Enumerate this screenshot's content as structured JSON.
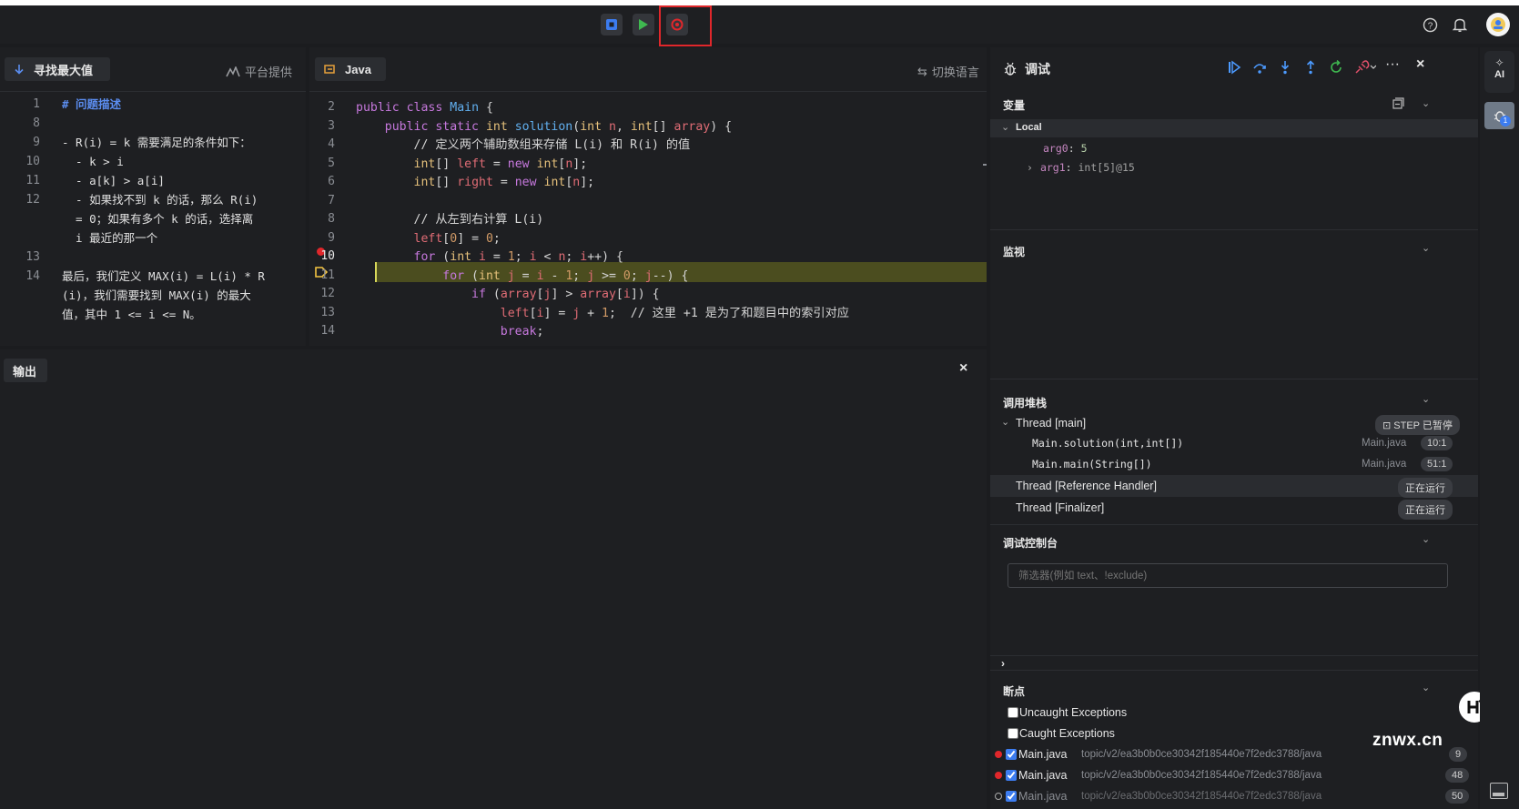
{
  "left_panel": {
    "tab_label": "寻找最大值",
    "provider_label": "平台提供",
    "lines": [
      {
        "num": "1",
        "text": "# 问题描述",
        "heading": true
      },
      {
        "num": "8",
        "text": ""
      },
      {
        "num": "9",
        "text": "- R(i) = k 需要满足的条件如下："
      },
      {
        "num": "10",
        "text": "  - k > i"
      },
      {
        "num": "11",
        "text": "  - a[k] > a[i]"
      },
      {
        "num": "12",
        "text": "  - 如果找不到 k 的话，那么 R(i)"
      },
      {
        "num": "",
        "text": "  = 0；如果有多个 k 的话，选择离"
      },
      {
        "num": "",
        "text": "  i 最近的那一个"
      },
      {
        "num": "13",
        "text": ""
      },
      {
        "num": "14",
        "text": "最后，我们定义 MAX(i) = L(i) * R"
      },
      {
        "num": "",
        "text": "(i)，我们需要找到 MAX(i) 的最大"
      },
      {
        "num": "",
        "text": "值，其中 1 <= i <= N。"
      }
    ]
  },
  "editor": {
    "tab_label": "Java",
    "switch_lang_label": "切换语言",
    "lines": [
      {
        "num": "2",
        "code": "public class Main {"
      },
      {
        "num": "3",
        "code": "    public static int solution(int n, int[] array) {"
      },
      {
        "num": "4",
        "code": "        // 定义两个辅助数组来存储 L(i) 和 R(i) 的值"
      },
      {
        "num": "5",
        "code": "        int[] left = new int[n];"
      },
      {
        "num": "6",
        "code": "        int[] right = new int[n];"
      },
      {
        "num": "7",
        "code": ""
      },
      {
        "num": "8",
        "code": "        // 从左到右计算 L(i)"
      },
      {
        "num": "9",
        "code": "        left[0] = 0;"
      },
      {
        "num": "10",
        "code": "        for (int i = 1; i < n; i++) {"
      },
      {
        "num": "11",
        "code": "            for (int j = i - 1; j >= 0; j--) {"
      },
      {
        "num": "12",
        "code": "                if (array[j] > array[i]) {"
      },
      {
        "num": "13",
        "code": "                    left[i] = j + 1;  // 这里 +1 是为了和题目中的索引对应"
      },
      {
        "num": "14",
        "code": "                    break;"
      }
    ]
  },
  "output": {
    "tab_label": "输出"
  },
  "debug": {
    "title": "调试",
    "variables": {
      "title": "变量",
      "scope": "Local",
      "items": [
        {
          "name": "arg0",
          "value": "5"
        },
        {
          "name": "arg1",
          "value": "int[5]@15"
        }
      ]
    },
    "watch": {
      "title": "监视"
    },
    "callstack": {
      "title": "调用堆栈",
      "threads": [
        {
          "name": "Thread [main]",
          "status": "STEP 已暂停"
        },
        {
          "name": "Thread [Reference Handler]",
          "status": "正在运行"
        },
        {
          "name": "Thread [Finalizer]",
          "status": "正在运行"
        }
      ],
      "frames": [
        {
          "name": "Main.solution(int,int[])",
          "file": "Main.java",
          "pos": "10:1"
        },
        {
          "name": "Main.main(String[])",
          "file": "Main.java",
          "pos": "51:1"
        }
      ]
    },
    "console": {
      "title": "调试控制台",
      "filter_placeholder": "筛选器(例如 text、!exclude)"
    },
    "breakpoints": {
      "title": "断点",
      "exceptions": [
        {
          "label": "Uncaught Exceptions",
          "checked": false
        },
        {
          "label": "Caught Exceptions",
          "checked": false
        }
      ],
      "items": [
        {
          "file": "Main.java",
          "path": "topic/v2/ea3b0b0ce30342f185440e7f2edc3788/java",
          "line": "9"
        },
        {
          "file": "Main.java",
          "path": "topic/v2/ea3b0b0ce30342f185440e7f2edc3788/java",
          "line": "48"
        },
        {
          "file": "Main.java",
          "path": "topic/v2/ea3b0b0ce30342f185440e7f2edc3788/java",
          "line": "50"
        }
      ]
    }
  },
  "right_rail": {
    "ai_label": "AI",
    "badge": "1"
  },
  "watermark": "znwx.cn",
  "colors": {
    "accent": "#3c7cf0",
    "breakpoint": "#e0272b",
    "current_line": "#4b4d1f",
    "run_green": "#3fb950",
    "highlight_box": "#e0272b"
  }
}
